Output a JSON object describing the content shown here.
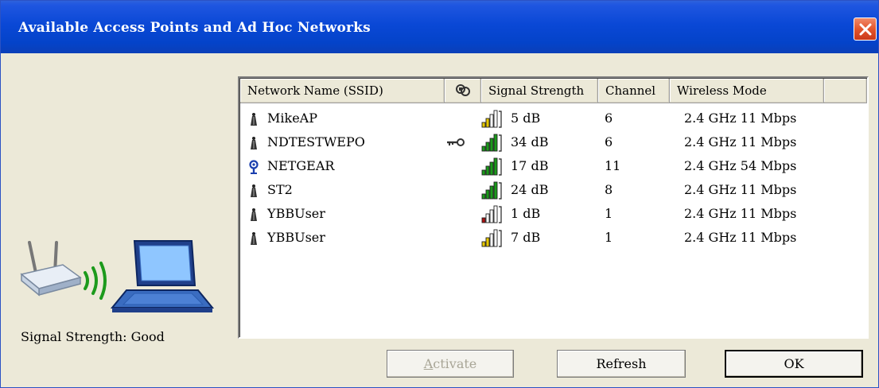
{
  "window": {
    "title": "Available Access Points and Ad Hoc Networks"
  },
  "list": {
    "columns": [
      "Network Name (SSID)",
      "",
      "Signal Strength",
      "Channel",
      "Wireless Mode"
    ],
    "rows": [
      {
        "ssid": "MikeAP",
        "type": "infrastructure",
        "secured": false,
        "signal_level": "low",
        "signal": "5 dB",
        "channel": "6",
        "mode": "2.4 GHz 11 Mbps"
      },
      {
        "ssid": "NDTESTWEPO",
        "type": "infrastructure",
        "secured": true,
        "signal_level": "high",
        "signal": "34 dB",
        "channel": "6",
        "mode": "2.4 GHz 11 Mbps"
      },
      {
        "ssid": "NETGEAR",
        "type": "connected",
        "secured": false,
        "signal_level": "high",
        "signal": "17 dB",
        "channel": "11",
        "mode": "2.4 GHz 54 Mbps"
      },
      {
        "ssid": "ST2",
        "type": "infrastructure",
        "secured": false,
        "signal_level": "high",
        "signal": "24 dB",
        "channel": "8",
        "mode": "2.4 GHz 11 Mbps"
      },
      {
        "ssid": "YBBUser",
        "type": "infrastructure",
        "secured": false,
        "signal_level": "very-low",
        "signal": "1 dB",
        "channel": "1",
        "mode": "2.4 GHz 11 Mbps"
      },
      {
        "ssid": "YBBUser",
        "type": "infrastructure",
        "secured": false,
        "signal_level": "low",
        "signal": "7 dB",
        "channel": "1",
        "mode": "2.4 GHz 11 Mbps"
      }
    ]
  },
  "status": {
    "signal_label": "Signal Strength:  Good"
  },
  "buttons": {
    "activate": "Activate",
    "refresh": "Refresh",
    "ok": "OK"
  },
  "colors": {
    "titlebar": "#0a48d6",
    "signal_green": "#1a9a1a",
    "signal_yellow": "#e6c800",
    "signal_red": "#b01010",
    "close_button": "#e3552c"
  }
}
